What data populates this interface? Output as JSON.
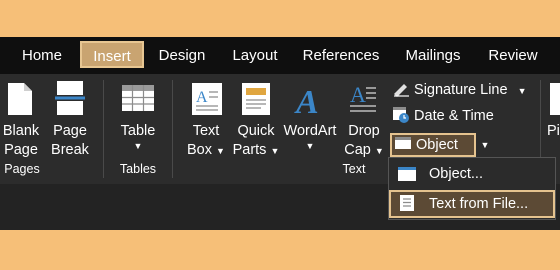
{
  "tabs": [
    "Home",
    "Insert",
    "Design",
    "Layout",
    "References",
    "Mailings",
    "Review"
  ],
  "pages": {
    "blank_page": [
      "Blank",
      "Page"
    ],
    "page_break": [
      "Page",
      "Break"
    ],
    "group": "Pages"
  },
  "tables": {
    "table": "Table",
    "group": "Tables"
  },
  "text": {
    "text_box": [
      "Text",
      "Box"
    ],
    "quick_parts": [
      "Quick",
      "Parts"
    ],
    "wordart": "WordArt",
    "drop_cap": [
      "Drop",
      "Cap"
    ],
    "signature_line": "Signature Line",
    "date_time": "Date & Time",
    "object": "Object",
    "group": "Text"
  },
  "right_cut": "Pi",
  "object_menu": {
    "object": "Object...",
    "text_from_file": "Text from File..."
  },
  "colors": {
    "accent": "#c9a471",
    "highlight_border": "#e5c38f",
    "background": "#f6bf78"
  }
}
